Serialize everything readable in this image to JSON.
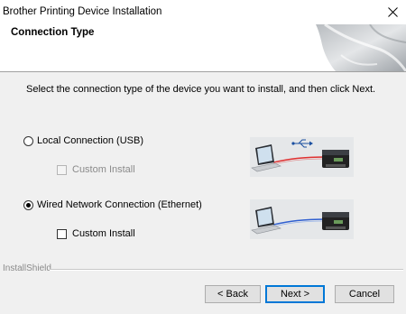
{
  "window": {
    "title": "Brother Printing Device Installation",
    "close_icon": "close-icon"
  },
  "header": {
    "title": "Connection Type"
  },
  "instruction": "Select the connection type of the device you want to install, and then click Next.",
  "options": {
    "local": {
      "label": "Local Connection (USB)",
      "selected": false,
      "custom_install_label": "Custom Install",
      "custom_install_checked": false,
      "custom_install_enabled": false,
      "illustration": "laptop-usb-printer-illustration"
    },
    "wired": {
      "label": "Wired Network Connection (Ethernet)",
      "selected": true,
      "custom_install_label": "Custom Install",
      "custom_install_checked": false,
      "custom_install_enabled": true,
      "illustration": "laptop-ethernet-printer-illustration"
    }
  },
  "footer": {
    "brand": "InstallShield",
    "back_label": "< Back",
    "next_label": "Next >",
    "cancel_label": "Cancel"
  }
}
